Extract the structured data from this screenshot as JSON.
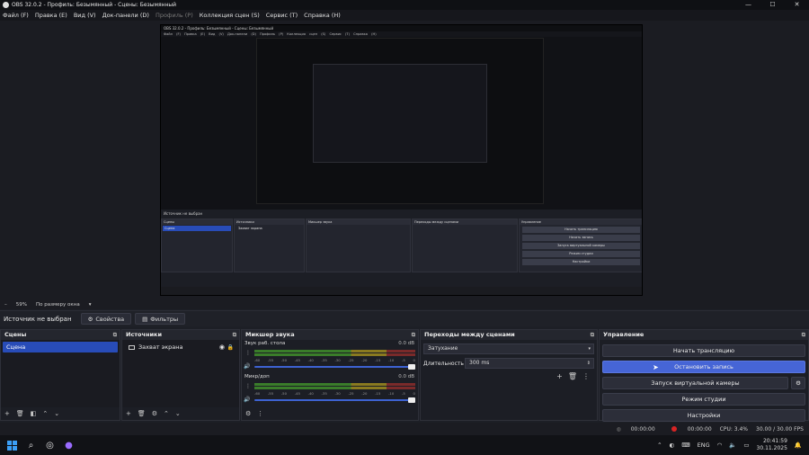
{
  "window": {
    "title": "OBS 32.0.2 - Профиль: Безымянный - Сцены: Безымянный",
    "controls": [
      "—",
      "☐",
      "✕"
    ]
  },
  "menu": [
    {
      "label": "Файл (F)"
    },
    {
      "label": "Правка (E)"
    },
    {
      "label": "Вид (V)"
    },
    {
      "label": "Док-панели (D)"
    },
    {
      "label": "Профиль (P)",
      "disabled": true
    },
    {
      "label": "Коллекция сцен (S)"
    },
    {
      "label": "Сервис (T)"
    },
    {
      "label": "Справка (H)"
    }
  ],
  "preview": {
    "nested_title": "OBS 32.0.2 - Профиль: Безымянный - Сцены: Безымянный",
    "nested_menu": "Файл (F) Правка (E) Вид (V) Док-панели (D) Профиль (P) Коллекция сцен (S) Сервис (T) Справка (H)",
    "nested_source_label": "Источник не выбран",
    "nested_docks": [
      "Сцены",
      "Источники",
      "Микшер звука",
      "Переходы между сценами",
      "Управление"
    ],
    "nested_scene": "Сцена",
    "nested_source": "Захват экрана",
    "nested_buttons": [
      "Начать трансляцию",
      "Начать запись",
      "Запуск виртуальной камеры",
      "Режим студии",
      "Настройки"
    ]
  },
  "zoom": {
    "level": "59%",
    "mode": "По размеру окна"
  },
  "source_bar": {
    "label": "Источник не выбран",
    "properties": "Свойства",
    "filters": "Фильтры"
  },
  "scenes": {
    "title": "Сцены",
    "items": [
      "Сцена"
    ]
  },
  "sources": {
    "title": "Источники",
    "items": [
      "Захват экрана"
    ]
  },
  "mixer": {
    "title": "Микшер звука",
    "ticks": [
      "-60",
      "-55",
      "-50",
      "-45",
      "-40",
      "-35",
      "-30",
      "-25",
      "-20",
      "-15",
      "-10",
      "-5",
      "0"
    ],
    "channels": [
      {
        "name": "Звук раб. стола",
        "db": "0.0 dB"
      },
      {
        "name": "Микр/доп",
        "db": "0.0 dB"
      }
    ]
  },
  "transitions": {
    "title": "Переходы между сценами",
    "selected": "Затухание",
    "duration_label": "Длительность",
    "duration_value": "300 ms"
  },
  "controls": {
    "title": "Управление",
    "start_stream": "Начать трансляцию",
    "stop_record": "Остановить запись",
    "virtual_cam": "Запуск виртуальной камеры",
    "studio_mode": "Режим студии",
    "settings": "Настройки"
  },
  "status": {
    "stream_time": "00:00:00",
    "rec_time": "00:00:00",
    "cpu": "CPU: 3.4%",
    "fps": "30.00 / 30.00 FPS"
  },
  "tray": {
    "lang": "ENG",
    "time": "20:41:59",
    "date": "30.11.2025"
  },
  "colors": {
    "accent": "#4665d6",
    "rec": "#d82424"
  }
}
